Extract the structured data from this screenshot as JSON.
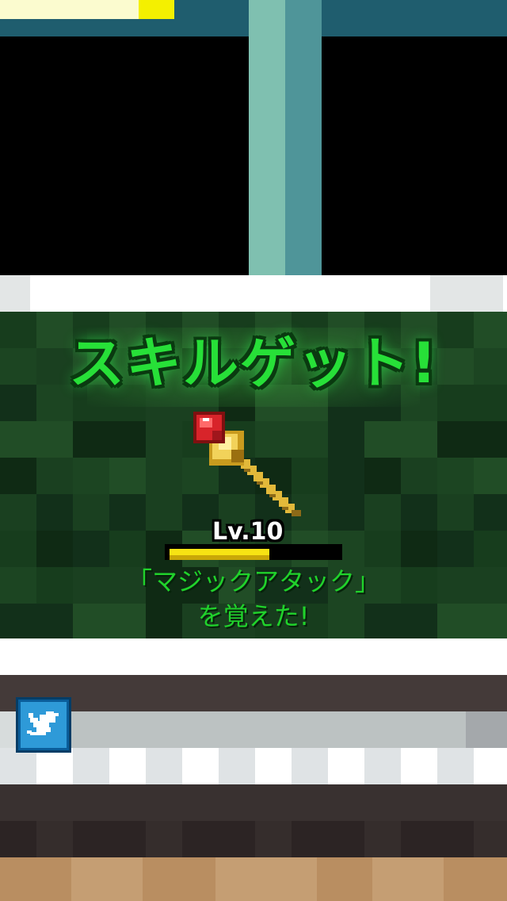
{
  "hud": {
    "hp_fraction": 0.34
  },
  "skill_popup": {
    "title": "スキルゲット!",
    "level_label": "Lv.10",
    "exp_fraction": 0.58,
    "skill_line": "「マジックアタック」",
    "learned_line": "を覚えた!",
    "item_icon": "magic-staff-icon",
    "colors": {
      "title_green": "#27e038",
      "text_green": "#20d22b",
      "exp_yellow": "#f7e313",
      "panel_bg": "#14361a"
    }
  },
  "share": {
    "icon": "twitter-bird-icon",
    "colors": {
      "button_blue": "#2e9ad8"
    }
  }
}
